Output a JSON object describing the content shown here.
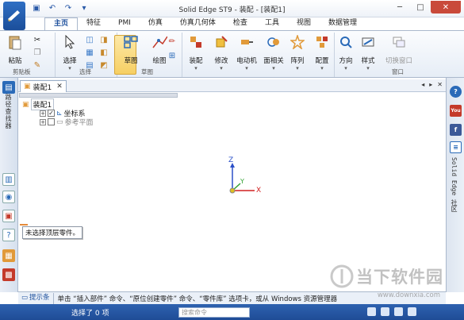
{
  "window": {
    "title": "Solid Edge ST9 - 装配 - [装配1]"
  },
  "ribbon": {
    "tabs": [
      "主页",
      "特征",
      "PMI",
      "仿真",
      "仿真几何体",
      "检查",
      "工具",
      "视图",
      "数据管理"
    ],
    "active_tab": "主页",
    "groups": {
      "clipboard": "剪贴板",
      "select": "选择",
      "sketch": "草图"
    },
    "buttons": {
      "paste": "粘贴",
      "select": "选择",
      "sketch_big": "草图",
      "draw": "绘图",
      "assemble": "装配",
      "modify": "修改",
      "motor": "电动机",
      "face_relate": "面相关",
      "pattern": "阵列",
      "configure": "配置",
      "orient": "方向",
      "style": "样式",
      "switch_window": "切换窗口",
      "window_group": "窗口"
    }
  },
  "left_panel": {
    "vertical_label": "路径查找器"
  },
  "right_panel": {
    "vertical_label": "Solid Edge 社区",
    "help_icon": "?",
    "youtube": "You",
    "facebook": "f"
  },
  "document": {
    "tab_label": "装配1",
    "tree": {
      "root": "装配1",
      "items": [
        "坐标系",
        "参考平面"
      ]
    },
    "tooltip": "未选择顶层零件。"
  },
  "axes": {
    "x_label": "X",
    "y_label": "Y",
    "z_label": "Z"
  },
  "prompt": {
    "button": "提示条",
    "text": "单击 “插入部件” 命令、“原位创建零件” 命令、“零件库” 选项卡，或从 Windows 资源管理器"
  },
  "status": {
    "selection": "选择了 0 项",
    "command_search_placeholder": "搜索命令"
  },
  "watermark": {
    "text": "当下软件园",
    "url": "www.downxia.com"
  },
  "colors": {
    "accent": "#1f4c96",
    "ribbon_bg": "#e6edf6",
    "select_highlight": "#f6cf63"
  }
}
